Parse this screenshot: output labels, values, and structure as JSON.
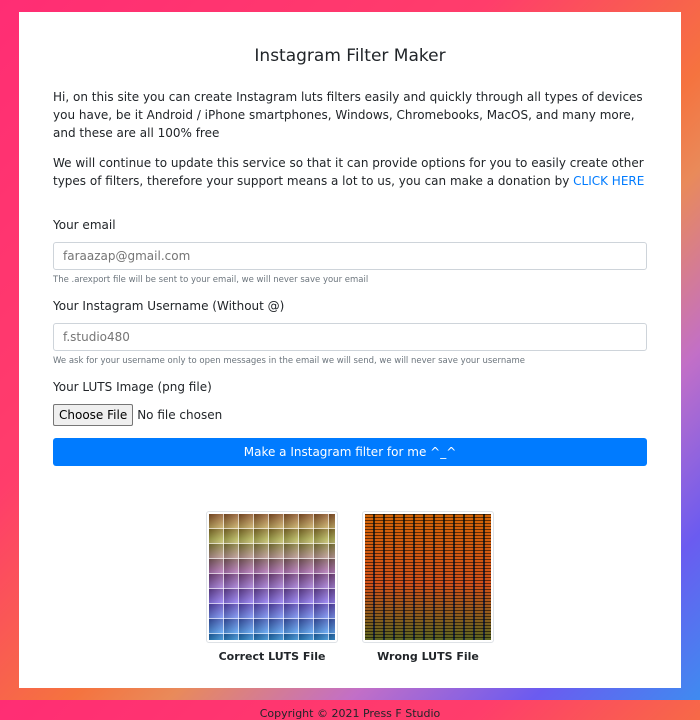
{
  "page": {
    "title": "Instagram Filter Maker",
    "intro": "Hi, on this site you can create Instagram luts filters easily and quickly through all types of devices you have, be it Android / iPhone smartphones, Windows, Chromebooks, MacOS, and many more, and these are all 100% free",
    "update_text": "We will continue to update this service so that it can provide options for you to easily create other types of filters, therefore your support means a lot to us, you can make a donation by ",
    "donate_link": "CLICK HERE"
  },
  "form": {
    "email_label": "Your email",
    "email_placeholder": "faraazap@gmail.com",
    "email_hint": "The .arexport file will be sent to your email, we will never save your email",
    "username_label": "Your Instagram Username (Without @)",
    "username_placeholder": "f.studio480",
    "username_hint": "We ask for your username only to open messages in the email we will send, we will never save your username",
    "luts_label": "Your LUTS Image (png file)",
    "file_button": "Choose File",
    "file_status": "No file chosen",
    "submit_label": "Make a Instagram filter for me ^_^"
  },
  "examples": {
    "correct_caption": "Correct LUTS File",
    "wrong_caption": "Wrong LUTS File"
  },
  "footer": {
    "copyright": "Copyright © 2021 Press F Studio"
  },
  "colors": {
    "accent": "#007bff",
    "text": "#212529",
    "muted": "#6c757d"
  }
}
